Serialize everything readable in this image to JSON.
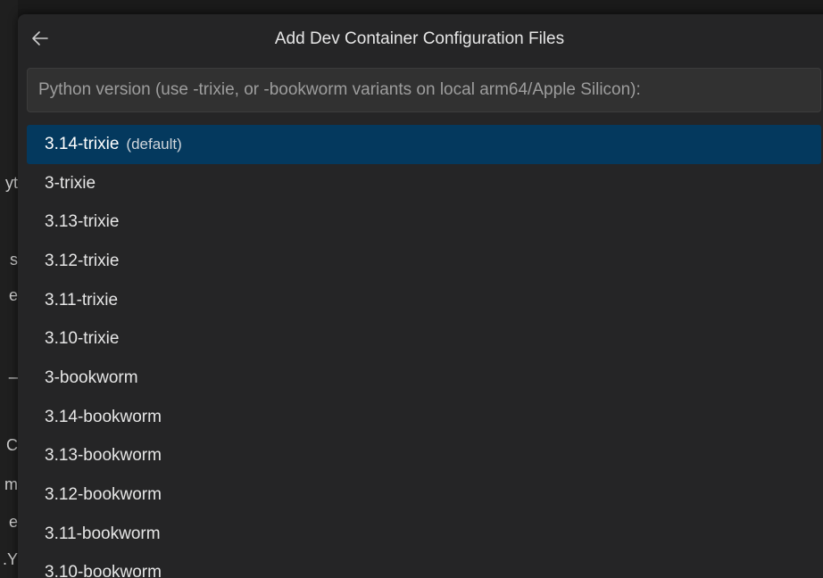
{
  "background_editor": {
    "fragments": [
      "yt",
      "s",
      "e",
      "_",
      "C",
      "m",
      "e",
      "Y."
    ]
  },
  "quick_pick": {
    "title": "Add Dev Container Configuration Files",
    "back_icon": "arrow-left-icon",
    "search": {
      "placeholder": "Python version (use -trixie, or -bookworm variants on local arm64/Apple Silicon):",
      "value": ""
    },
    "items": [
      {
        "label": "3.14-trixie",
        "description": "(default)",
        "selected": true
      },
      {
        "label": "3-trixie",
        "description": "",
        "selected": false
      },
      {
        "label": "3.13-trixie",
        "description": "",
        "selected": false
      },
      {
        "label": "3.12-trixie",
        "description": "",
        "selected": false
      },
      {
        "label": "3.11-trixie",
        "description": "",
        "selected": false
      },
      {
        "label": "3.10-trixie",
        "description": "",
        "selected": false
      },
      {
        "label": "3-bookworm",
        "description": "",
        "selected": false
      },
      {
        "label": "3.14-bookworm",
        "description": "",
        "selected": false
      },
      {
        "label": "3.13-bookworm",
        "description": "",
        "selected": false
      },
      {
        "label": "3.12-bookworm",
        "description": "",
        "selected": false
      },
      {
        "label": "3.11-bookworm",
        "description": "",
        "selected": false
      },
      {
        "label": "3.10-bookworm",
        "description": "",
        "selected": false
      }
    ]
  },
  "colors": {
    "selection": "#04395e",
    "panel": "#252526",
    "input": "#313131"
  }
}
